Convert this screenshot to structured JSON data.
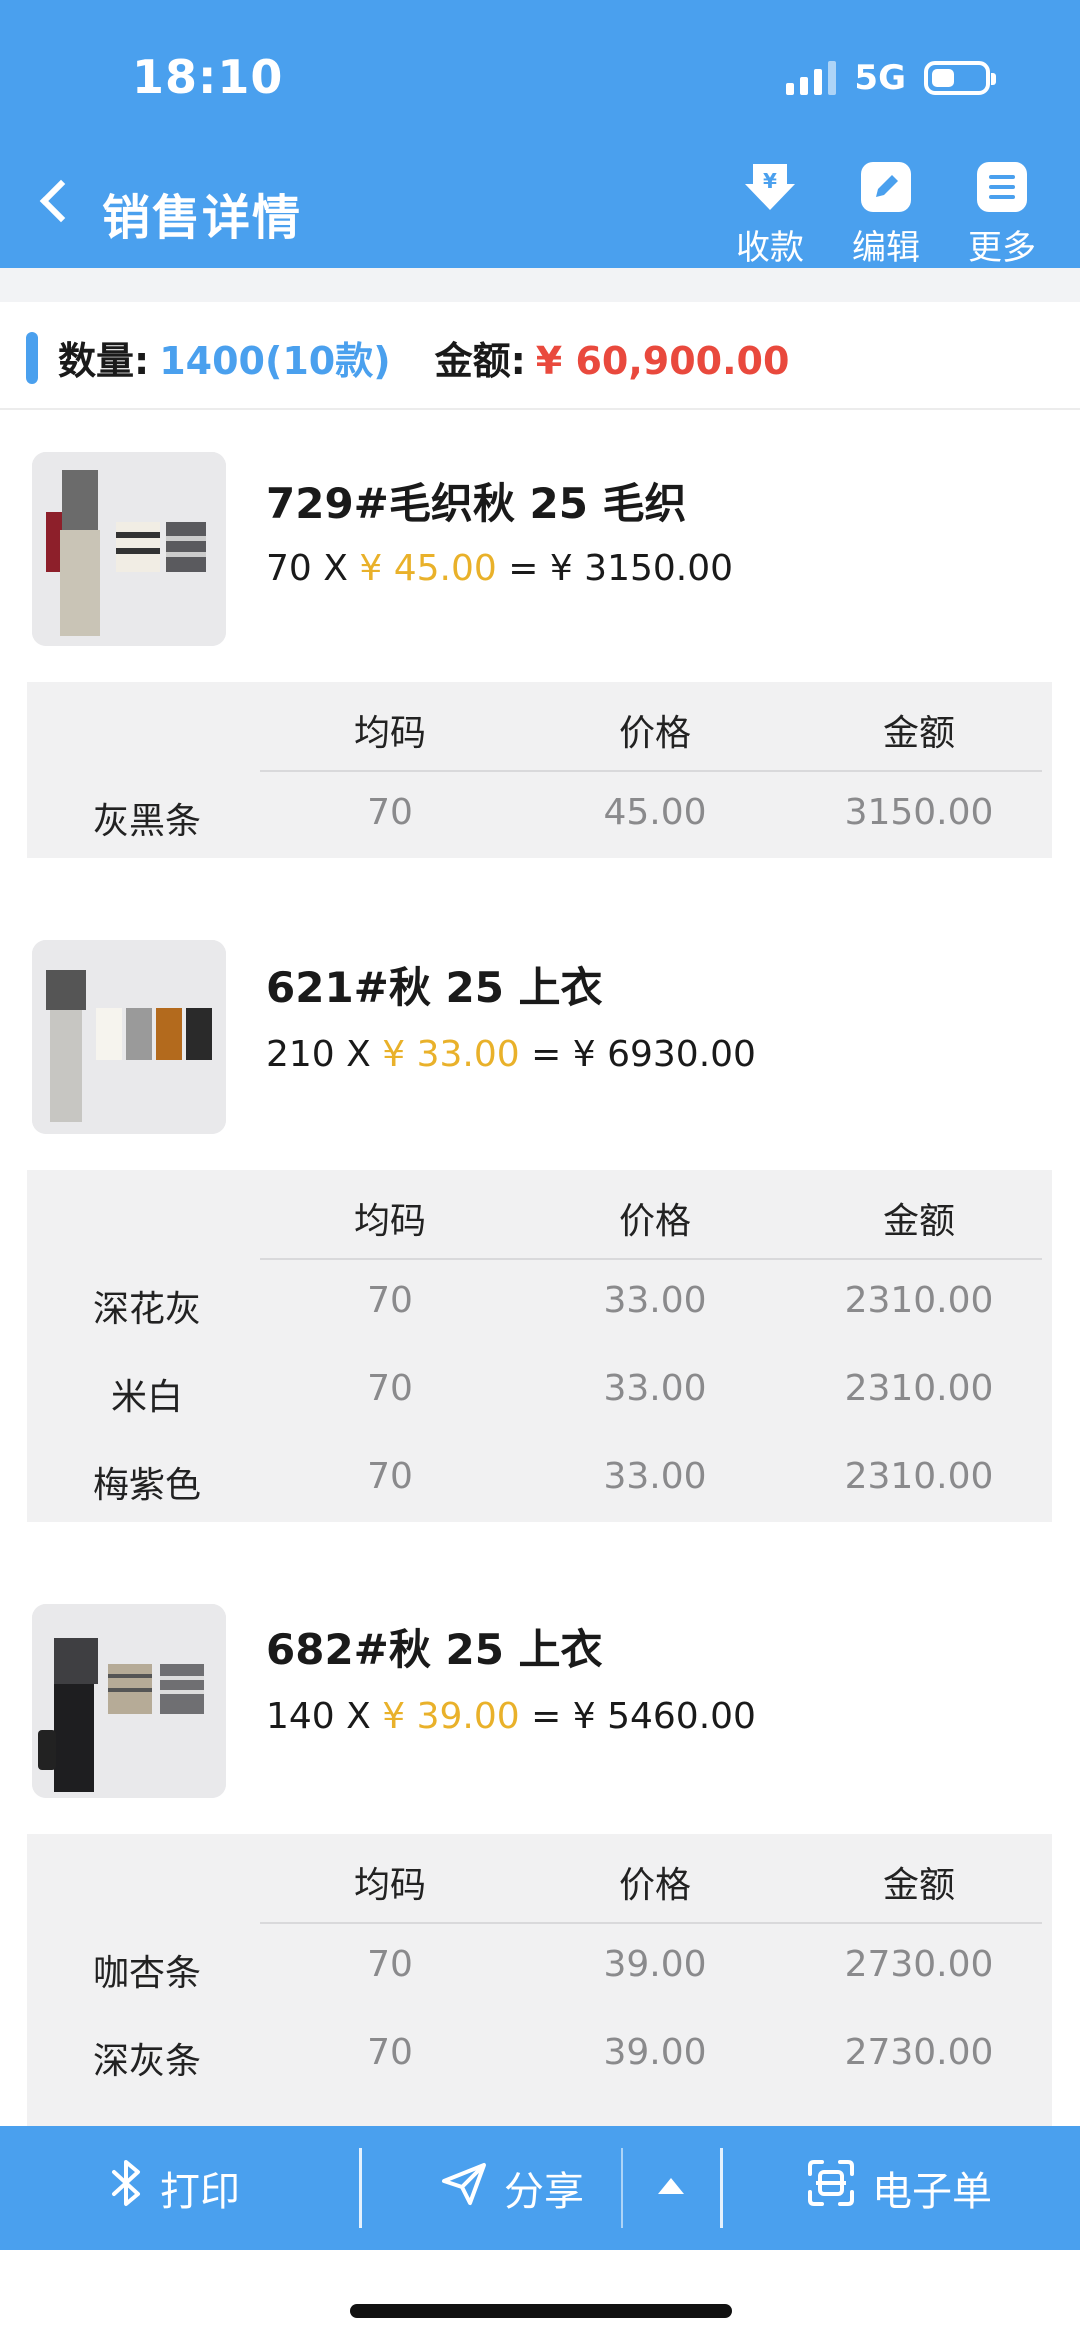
{
  "status_bar": {
    "time": "18:10",
    "network": "5G"
  },
  "header": {
    "title": "销售详情",
    "actions": [
      {
        "label": "收款",
        "icon": "payment-icon"
      },
      {
        "label": "编辑",
        "icon": "edit-icon"
      },
      {
        "label": "更多",
        "icon": "more-icon"
      }
    ]
  },
  "summary": {
    "qty_label": "数量:",
    "qty_value": "1400",
    "qty_kinds": "(10款)",
    "amount_label": "金额:",
    "amount_value": "¥ 60,900.00"
  },
  "table_headers": {
    "size": "均码",
    "price": "价格",
    "amount": "金额"
  },
  "products": [
    {
      "name": "729#毛织秋 25 毛织",
      "qty": "70 X ",
      "unit_price": "¥ 45.00",
      "total": " = ¥ 3150.00",
      "rows": [
        {
          "color": "灰黑条",
          "size_qty": "70",
          "price": "45.00",
          "amount": "3150.00"
        }
      ]
    },
    {
      "name": "621#秋 25 上衣",
      "qty": "210 X ",
      "unit_price": "¥ 33.00",
      "total": " = ¥ 6930.00",
      "rows": [
        {
          "color": "深花灰",
          "size_qty": "70",
          "price": "33.00",
          "amount": "2310.00"
        },
        {
          "color": "米白",
          "size_qty": "70",
          "price": "33.00",
          "amount": "2310.00"
        },
        {
          "color": "梅紫色",
          "size_qty": "70",
          "price": "33.00",
          "amount": "2310.00"
        }
      ]
    },
    {
      "name": "682#秋 25 上衣",
      "qty": "140 X ",
      "unit_price": "¥ 39.00",
      "total": " = ¥ 5460.00",
      "rows": [
        {
          "color": "咖杏条",
          "size_qty": "70",
          "price": "39.00",
          "amount": "2730.00"
        },
        {
          "color": "深灰条",
          "size_qty": "70",
          "price": "39.00",
          "amount": "2730.00"
        }
      ]
    }
  ],
  "bottom_bar": {
    "print_label": "打印",
    "share_label": "分享",
    "ereceipt_label": "电子单"
  },
  "colors": {
    "primary": "#4aa0ee",
    "amount_red": "#e9493d",
    "price_yellow": "#e9b12a"
  }
}
